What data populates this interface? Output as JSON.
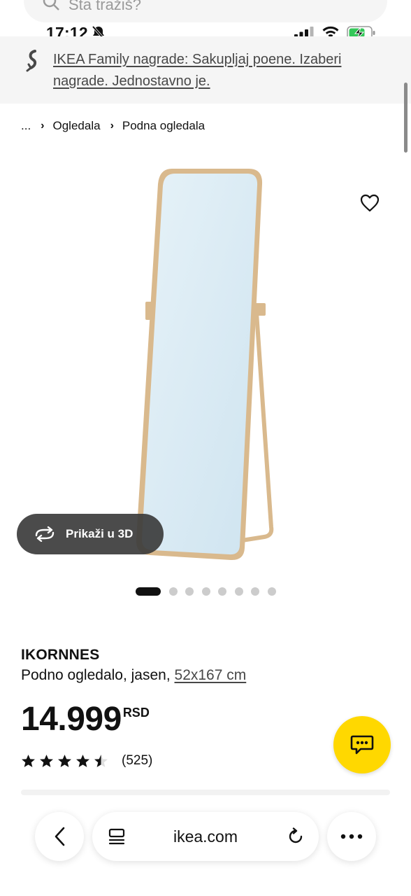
{
  "search": {
    "placeholder": "Šta tražiš?"
  },
  "status_bar": {
    "time": "17:12"
  },
  "promo_banner": {
    "text": "IKEA Family nagrade: Sakupljaj poene. Izaberi nagrade. Jednostavno je."
  },
  "breadcrumb": {
    "ellipsis": "...",
    "items": [
      "Ogledala",
      "Podna ogledala"
    ]
  },
  "gallery": {
    "view_3d_label": "Prikaži u 3D",
    "slide_count": 8,
    "active_slide": 1
  },
  "product": {
    "name": "IKORNNES",
    "description": "Podno ogledalo, jasen,",
    "size": "52x167 cm",
    "price": "14.999",
    "currency": "RSD",
    "rating_value": 4.5,
    "rating_max": 5,
    "review_count": "(525)"
  },
  "browser": {
    "url": "ikea.com"
  },
  "colors": {
    "accent_yellow": "#ffd800",
    "banner_bg": "#f5f5f5",
    "mirror_frame": "#d9b98d",
    "mirror_glass": "#dcedf6"
  },
  "icons": [
    "search-icon",
    "bell-slash-icon",
    "signal-icon",
    "wifi-icon",
    "battery-charging-icon",
    "family-link-icon",
    "heart-icon",
    "rotate-3d-icon",
    "chat-icon",
    "back-icon",
    "reader-icon",
    "reload-icon",
    "more-icon"
  ]
}
